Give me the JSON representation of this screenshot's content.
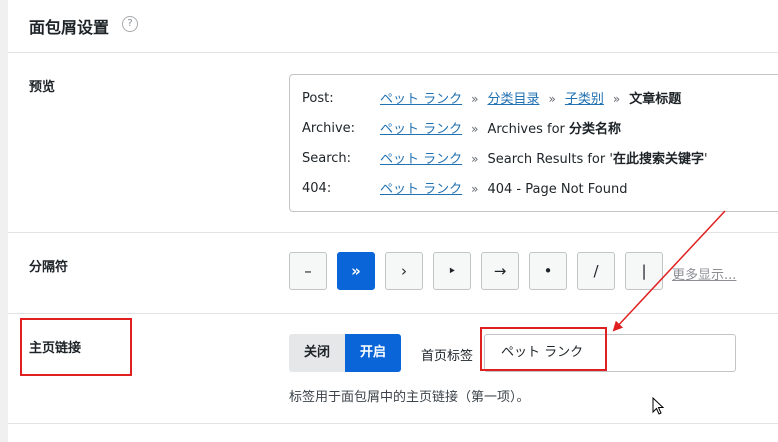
{
  "header": {
    "title": "面包屑设置",
    "help_icon": "?"
  },
  "preview": {
    "label": "预览",
    "rows": [
      {
        "key": "Post:",
        "home": "ペット ランク",
        "sep": "»",
        "cat1": "分类目录",
        "cat2": "子类别",
        "last": "文章标题"
      },
      {
        "key": "Archive:",
        "home": "ペット ランク",
        "sep": "»",
        "text": "Archives for ",
        "strong": "分类名称"
      },
      {
        "key": "Search:",
        "home": "ペット ランク",
        "sep": "»",
        "text": "Search Results for '",
        "strong": "在此搜索关键字",
        "text_end": "'"
      },
      {
        "key": "404:",
        "home": "ペット ランク",
        "sep": "»",
        "text": "404 - Page Not Found"
      }
    ]
  },
  "separator": {
    "label": "分隔符",
    "options": [
      "–",
      "»",
      "›",
      "‣",
      "→",
      "•",
      "/",
      "|"
    ],
    "selected": "»",
    "more_label": "更多显示..."
  },
  "home_link": {
    "label": "主页链接",
    "toggle_off": "关闭",
    "toggle_on": "开启",
    "toggle_state": "开启",
    "field_label": "首页标签",
    "field_value": "ペット ランク",
    "description": "标签用于面包屑中的主页链接（第一项）。"
  },
  "colors": {
    "accent": "#0a66d8",
    "link": "#2271b1",
    "annotation": "#e02020"
  }
}
